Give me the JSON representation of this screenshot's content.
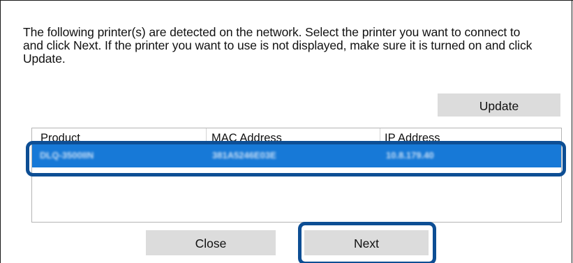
{
  "dialog": {
    "message_lines": [
      "The following printer(s) are detected on the network. Select the printer you want to connect to",
      "and click Next. If the printer you want to use is not displayed, make sure it is turned on and click",
      "Update."
    ]
  },
  "buttons": {
    "update_label": "Update",
    "close_label": "Close",
    "next_label": "Next"
  },
  "printer_list": {
    "columns": [
      "Product",
      "MAC Address",
      "IP Address"
    ],
    "rows": [
      {
        "product": "DLQ-3500IIN",
        "mac": "381A5246E03E",
        "ip": "10.8.179.40",
        "selected": true
      }
    ]
  },
  "colors": {
    "selection": "#1779d7",
    "highlight_outline": "#0d4e94",
    "button_face": "#dcdcdc"
  }
}
